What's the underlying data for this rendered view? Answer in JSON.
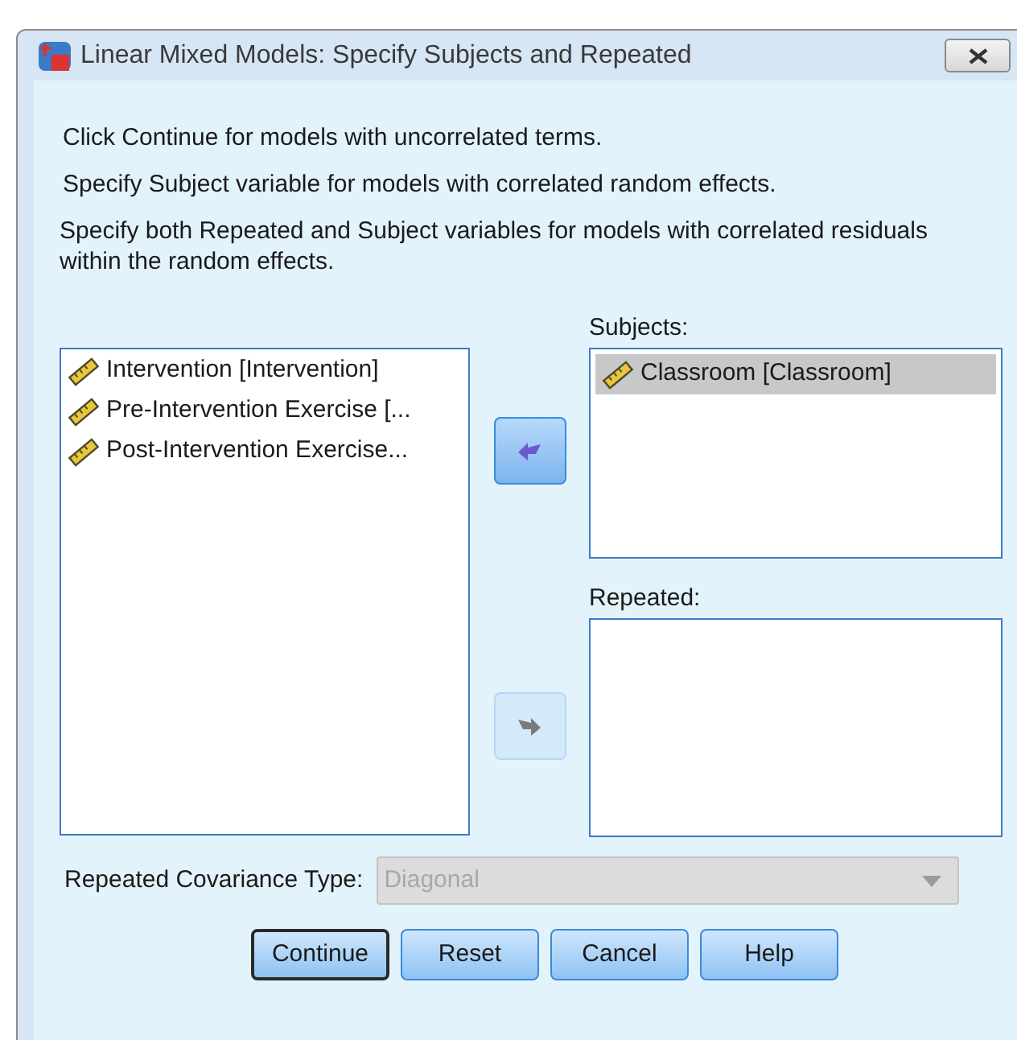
{
  "window": {
    "title": "Linear Mixed Models: Specify Subjects and Repeated"
  },
  "instructions": [
    "Click Continue for models with uncorrelated terms.",
    "Specify Subject variable for models with correlated random effects.",
    "Specify both Repeated and Subject variables for models with correlated residuals within the random effects."
  ],
  "variables": [
    {
      "label": "Intervention [Intervention]",
      "kind": "scale",
      "selected": false
    },
    {
      "label": "Pre-Intervention Exercise [...",
      "kind": "scale",
      "selected": false
    },
    {
      "label": "Post-Intervention Exercise...",
      "kind": "scale",
      "selected": false
    }
  ],
  "move_buttons": [
    {
      "kind": "left",
      "disabled": false
    },
    {
      "kind": "right",
      "disabled": true
    }
  ],
  "subjects": {
    "label": "Subjects:",
    "items": [
      {
        "label": "Classroom [Classroom]",
        "kind": "scale",
        "selected": true
      }
    ]
  },
  "repeated": {
    "label": "Repeated:"
  },
  "covariance": {
    "label": "Repeated Covariance Type:",
    "value": "Diagonal",
    "disabled": true
  },
  "buttons": [
    {
      "label": "Continue",
      "default": true
    },
    {
      "label": "Reset",
      "default": false
    },
    {
      "label": "Cancel",
      "default": false
    },
    {
      "label": "Help",
      "default": false
    }
  ]
}
